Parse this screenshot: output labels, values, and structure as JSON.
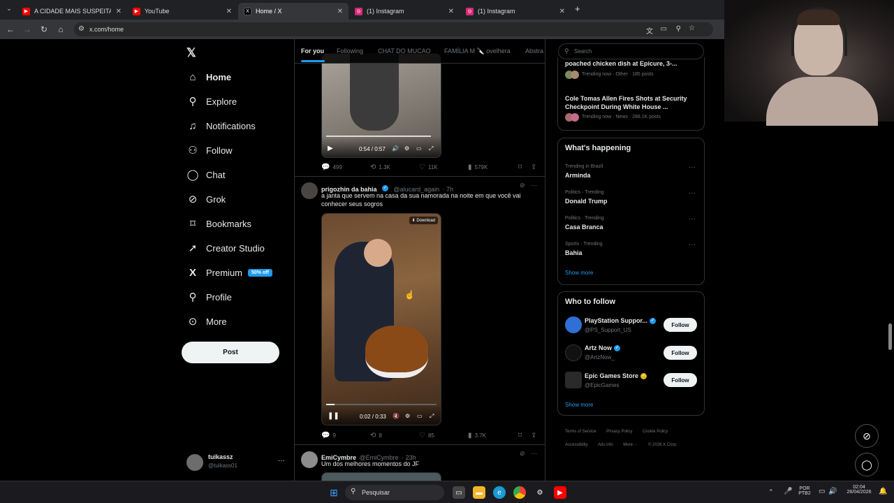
{
  "browser": {
    "tabs": [
      {
        "title": "A CIDADE MAIS SUSPEITA DO B",
        "icon": "youtube-icon",
        "color": "#ff0000"
      },
      {
        "title": "YouTube",
        "icon": "youtube-icon",
        "color": "#ff0000"
      },
      {
        "title": "Home / X",
        "icon": "x-icon",
        "color": "#000000"
      },
      {
        "title": "(1) Instagram",
        "icon": "instagram-icon",
        "color": "#d62976"
      },
      {
        "title": "(1) Instagram",
        "icon": "instagram-icon",
        "color": "#d62976"
      }
    ],
    "new_tab": "+",
    "url": "x.com/home"
  },
  "nav": {
    "logo": "𝕏",
    "items": [
      {
        "label": "Home",
        "icon": "home-icon",
        "glyph": "⌂"
      },
      {
        "label": "Explore",
        "icon": "search-icon",
        "glyph": "⚲"
      },
      {
        "label": "Notifications",
        "icon": "bell-icon",
        "glyph": "🔔"
      },
      {
        "label": "Follow",
        "icon": "person-add-icon",
        "glyph": "👤"
      },
      {
        "label": "Chat",
        "icon": "chat-icon",
        "glyph": "◯"
      },
      {
        "label": "Grok",
        "icon": "grok-icon",
        "glyph": "⊘"
      },
      {
        "label": "Bookmarks",
        "icon": "bookmark-icon",
        "glyph": "🔖"
      },
      {
        "label": "Creator Studio",
        "icon": "rocket-icon",
        "glyph": "🚀"
      },
      {
        "label": "Premium",
        "icon": "x-icon",
        "glyph": "𝕏",
        "badge": "50% off"
      },
      {
        "label": "Profile",
        "icon": "profile-icon",
        "glyph": "👤"
      },
      {
        "label": "More",
        "icon": "more-icon",
        "glyph": "⊙"
      }
    ],
    "post_button": "Post",
    "account": {
      "name": "tuikassz",
      "handle": "@tuikass01",
      "more": "···"
    }
  },
  "feed": {
    "tabs": [
      "For you",
      "Following",
      "CHAT DO MUCAO",
      "FAMÍLIA M 🔪 ovelhera",
      "Abstra"
    ],
    "post0": {
      "video_time": "0:54 / 0:57",
      "replies": "499",
      "reposts": "1.3K",
      "likes": "11K",
      "views": "579K"
    },
    "post1": {
      "name": "prigozhin da bahia",
      "handle": "@alucard_again",
      "time": "· 7h",
      "text": "a janta que servem na casa da sua namorada na noite em que você vai conhecer seus sogros",
      "download": "Download",
      "video_time": "0:02 / 0:33",
      "replies": "9",
      "reposts": "8",
      "likes": "85",
      "views": "3.7K"
    },
    "post2": {
      "name": "EmiCymbre",
      "handle": "@EmiCymbre",
      "time": "· 23h",
      "text": "Um dos melhores momentos do JF"
    }
  },
  "right": {
    "search_placeholder": "Search",
    "news": [
      {
        "title": "poached chicken dish at Epicure, 3-...",
        "meta": "Trending now · Other · 185 posts"
      },
      {
        "title": "Cole Tomas Allen Fires Shots at Security Checkpoint During White House ...",
        "meta": "Trending now · News · 288.1K posts"
      }
    ],
    "happening": {
      "title": "What's happening",
      "trends": [
        {
          "meta": "Trending in Brazil",
          "title": "Arminda"
        },
        {
          "meta": "Politics · Trending",
          "title": "Donald Trump"
        },
        {
          "meta": "Politics · Trending",
          "title": "Casa Branca"
        },
        {
          "meta": "Sports · Trending",
          "title": "Bahia"
        }
      ],
      "show_more": "Show more"
    },
    "who_to_follow": {
      "title": "Who to follow",
      "accounts": [
        {
          "name": "PlayStation Suppor...",
          "handle": "@PS_Support_US",
          "verify": "blue",
          "follow": "Follow"
        },
        {
          "name": "Artz Now",
          "handle": "@ArtzNow_",
          "verify": "blue",
          "follow": "Follow"
        },
        {
          "name": "Epic Games Store",
          "handle": "@EpicGames",
          "verify": "gold",
          "follow": "Follow"
        }
      ],
      "show_more": "Show more"
    },
    "footer": [
      "Terms of Service",
      "Privacy Policy",
      "Cookie Policy",
      "Accessibility",
      "Ads info",
      "More ···",
      "© 2026 X Corp."
    ]
  },
  "taskbar": {
    "search": "Pesquisar",
    "lang1": "POR",
    "lang2": "PTB2",
    "time": "02:04",
    "date": "26/04/2026"
  }
}
